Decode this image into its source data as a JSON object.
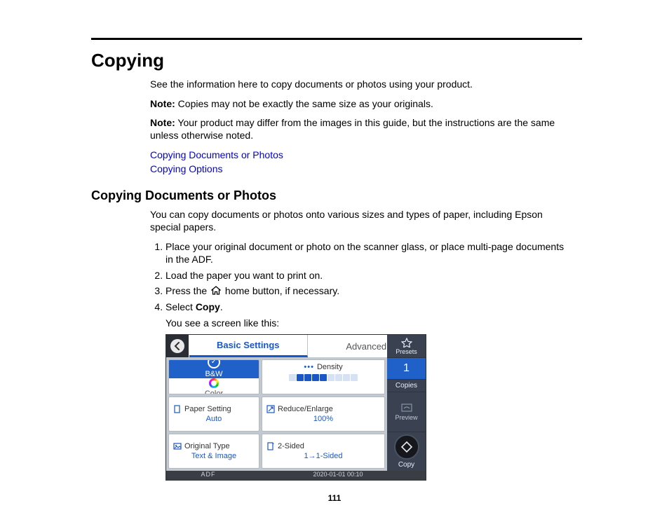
{
  "page": {
    "number": "111",
    "h1": "Copying",
    "intro": "See the information here to copy documents or photos using your product.",
    "note1_label": "Note:",
    "note1_text": " Copies may not be exactly the same size as your originals.",
    "note2_label": "Note:",
    "note2_text": " Your product may differ from the images in this guide, but the instructions are the same unless otherwise noted.",
    "links": {
      "a": "Copying Documents or Photos",
      "b": "Copying Options"
    },
    "h2": "Copying Documents or Photos",
    "section_intro": "You can copy documents or photos onto various sizes and types of paper, including Epson special papers.",
    "steps": {
      "s1": "Place your original document or photo on the scanner glass, or place multi-page documents in the ADF.",
      "s2": "Load the paper you want to print on.",
      "s3a": "Press the ",
      "s3b": " home button, if necessary.",
      "s4a": "Select ",
      "s4b": "Copy",
      "s4c": "."
    },
    "after_step4": "You see a screen like this:"
  },
  "screen": {
    "tabs": {
      "basic": "Basic Settings",
      "advanced": "Advanced"
    },
    "right": {
      "presets": "Presets",
      "copies_value": "1",
      "copies_label": "Copies",
      "preview": "Preview",
      "copy": "Copy"
    },
    "tiles": {
      "bw": "B&W",
      "color": "Color",
      "density_title": "Density",
      "paper_title": "Paper Setting",
      "paper_value": "Auto",
      "reduce_title": "Reduce/Enlarge",
      "reduce_value": "100%",
      "orig_title": "Original Type",
      "orig_value": "Text & Image",
      "twos_title": "2-Sided",
      "twos_value": "1→1-Sided"
    },
    "status": {
      "adf": "ADF",
      "timestamp": "2020-01-01 00:10"
    }
  }
}
